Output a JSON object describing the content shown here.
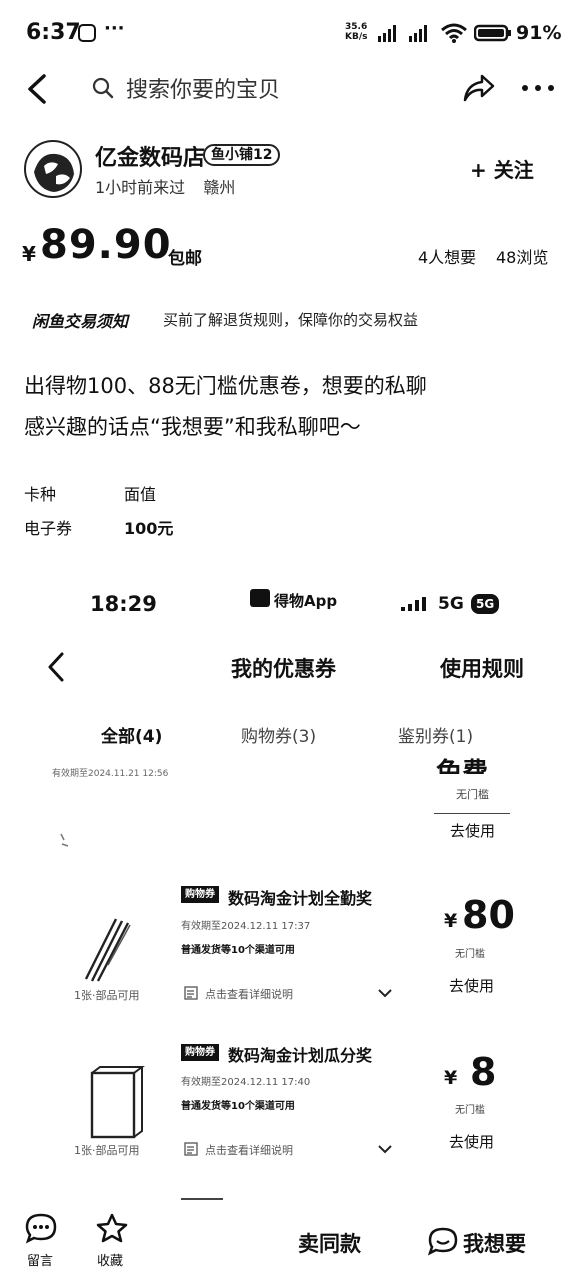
{
  "status_bar": {
    "time": "6:37",
    "network_speed_top": "35.6",
    "network_speed_bottom": "KB/s",
    "battery": "91%"
  },
  "nav": {
    "search_placeholder": "搜索你要的宝贝"
  },
  "seller": {
    "name": "亿金数码店",
    "badge": "鱼小铺12",
    "last_seen": "1小时前来过",
    "location": "赣州",
    "follow_label": "+ 关注"
  },
  "price": {
    "currency": "¥",
    "amount": "89.90",
    "shipping": "包邮",
    "wants": "4人想要",
    "views": "48浏览"
  },
  "notice": {
    "title": "闲鱼交易须知",
    "text": "买前了解退货规则，保障你的交易权益"
  },
  "description": {
    "line1": "出得物100、88无门槛优惠卷，想要的私聊",
    "line2": "感兴趣的话点“我想要”和我私聊吧～"
  },
  "attributes": [
    {
      "key": "卡种",
      "value": "面值"
    },
    {
      "key": "电子券",
      "value": "100元"
    }
  ],
  "embedded": {
    "time": "18:29",
    "app": "得物App",
    "network": "5G",
    "network_badge": "5G",
    "title": "我的优惠券",
    "rules": "使用规则",
    "tabs": [
      "全部(4)",
      "购物券(3)",
      "鉴别券(1)"
    ],
    "top_coupon": {
      "expiry": "有效期至2024.11.21 12:56",
      "amount": "免费",
      "condition": "无门槛",
      "use": "去使用"
    },
    "coupons": [
      {
        "tag": "购物券",
        "title": "数码淘金计划全勤奖",
        "expiry": "有效期至2024.12.11 17:37",
        "scope": "普通发货等10个渠道可用",
        "detail": "点击查看详细说明",
        "currency": "¥",
        "amount": "80",
        "condition": "无门槛",
        "use": "去使用",
        "image_caption": "1张·部品可用"
      },
      {
        "tag": "购物券",
        "title": "数码淘金计划瓜分奖",
        "expiry": "有效期至2024.12.11 17:40",
        "scope": "普通发货等10个渠道可用",
        "detail": "点击查看详细说明",
        "currency": "¥",
        "amount": "8",
        "condition": "无门槛",
        "use": "去使用",
        "image_caption": "1张·部品可用"
      }
    ]
  },
  "bottom_bar": {
    "message": "留言",
    "favorite": "收藏",
    "sell_same": "卖同款",
    "want": "我想要"
  }
}
